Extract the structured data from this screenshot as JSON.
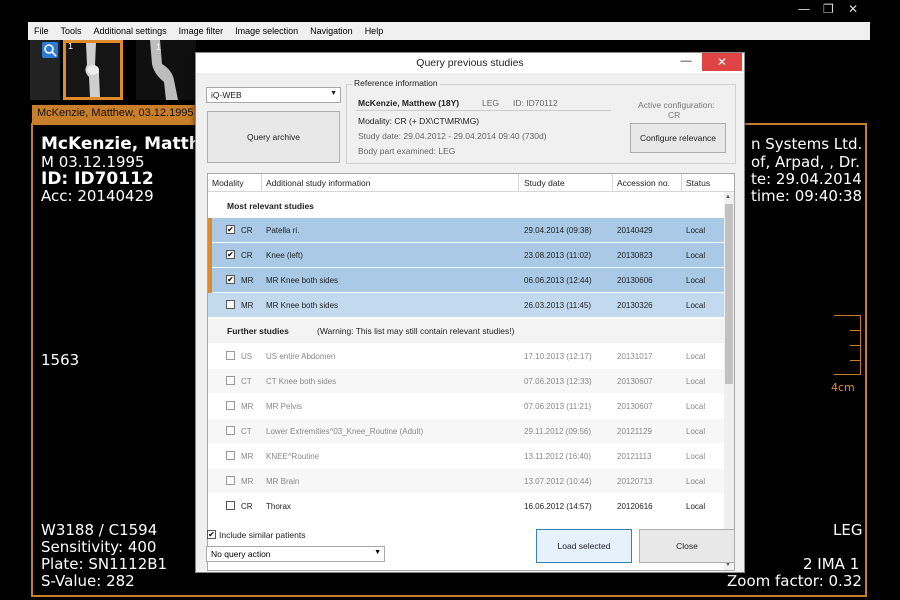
{
  "menu": [
    "File",
    "Tools",
    "Additional settings",
    "Image filter",
    "Image selection",
    "Navigation",
    "Help"
  ],
  "window_controls": {
    "minimize": "—",
    "restore": "❐",
    "close": "✕"
  },
  "thumbnails": [
    {
      "number": "1"
    },
    {
      "number": "1"
    }
  ],
  "viewer_tab": "McKenzie, Matthew, 03.12.1995",
  "overlay": {
    "patient_name": "McKenzie, Matthe",
    "birth": "M 03.12.1995",
    "id": "ID: ID70112",
    "acc": "Acc: 20140429",
    "institution": "n Systems Ltd.",
    "physician": "of, Arpad, , Dr.",
    "date": "te: 29.04.2014",
    "time": "time: 09:40:38",
    "left_mid": "1563",
    "scale": "4cm",
    "window": "W3188 / C1594",
    "sensitivity": "Sensitivity: 400",
    "plate": "Plate: SN1112B1",
    "svalue": "S-Value: 282",
    "side": "LEG",
    "ima": "2 IMA 1",
    "zoom": "Zoom factor: 0.32"
  },
  "dialog": {
    "title": "Query previous studies",
    "minimize": "—",
    "close": "✕",
    "source_select": "iQ-WEB",
    "query_button": "Query archive",
    "reference_legend": "Reference information",
    "ref_patient": "McKenzie, Matthew (18Y)",
    "ref_region": "LEG",
    "ref_id": "ID: ID70112",
    "ref_modality": "Modality: CR (+ DX\\CT\\MR\\MG)",
    "ref_study_date": "Study date: 29.04.2012 - 29.04.2014 09:40 (730d)",
    "ref_body_part": "Body part examined: LEG",
    "active_config_label": "Active configuration:",
    "active_config_value": "CR",
    "configure_button": "Configure relevance",
    "columns": [
      "Modality",
      "Additional study information",
      "Study date",
      "Accession no.",
      "Status"
    ],
    "group_relevant": "Most relevant studies",
    "group_further": "Further studies",
    "group_further_warning": "(Warning: This list may still contain relevant studies!)",
    "relevant_rows": [
      {
        "checked": "✔",
        "modality": "CR",
        "info": "Patella ri.",
        "date": "29.04.2014 (09:38)",
        "acc": "20140429",
        "status": "Local"
      },
      {
        "checked": "✔",
        "modality": "CR",
        "info": "Knee (left)",
        "date": "23.08.2013 (11:02)",
        "acc": "20130823",
        "status": "Local"
      },
      {
        "checked": "✔",
        "modality": "MR",
        "info": "MR Knee both sides",
        "date": "06.06.2013 (12:44)",
        "acc": "20130606",
        "status": "Local"
      },
      {
        "checked": "",
        "modality": "MR",
        "info": "MR Knee both sides",
        "date": "26.03.2013 (11:45)",
        "acc": "20130326",
        "status": "Local"
      }
    ],
    "further_rows": [
      {
        "modality": "US",
        "info": "US entire Abdomen",
        "date": "17.10.2013 (12:17)",
        "acc": "20131017",
        "status": "Local"
      },
      {
        "modality": "CT",
        "info": "CT Knee both sides",
        "date": "07.06.2013 (12:33)",
        "acc": "20130607",
        "status": "Local"
      },
      {
        "modality": "MR",
        "info": "MR Pelvis",
        "date": "07.06.2013 (11:21)",
        "acc": "20130607",
        "status": "Local"
      },
      {
        "modality": "CT",
        "info": "Lower Extremities^03_Knee_Routine (Adult)",
        "date": "29.11.2012 (09:56)",
        "acc": "20121129",
        "status": "Local"
      },
      {
        "modality": "MR",
        "info": "KNEE^Routine",
        "date": "13.11.2012 (16:40)",
        "acc": "20121113",
        "status": "Local"
      },
      {
        "modality": "MR",
        "info": "MR Brain",
        "date": "13.07.2012 (10:44)",
        "acc": "20120713",
        "status": "Local"
      },
      {
        "modality": "CR",
        "info": "Thorax",
        "date": "16.06.2012 (14:57)",
        "acc": "20120616",
        "status": "Local"
      }
    ],
    "include_similar_checked": "✔",
    "include_similar_label": "Include similar patients",
    "action_select": "No query action",
    "load_button": "Load selected",
    "close_button": "Close"
  }
}
